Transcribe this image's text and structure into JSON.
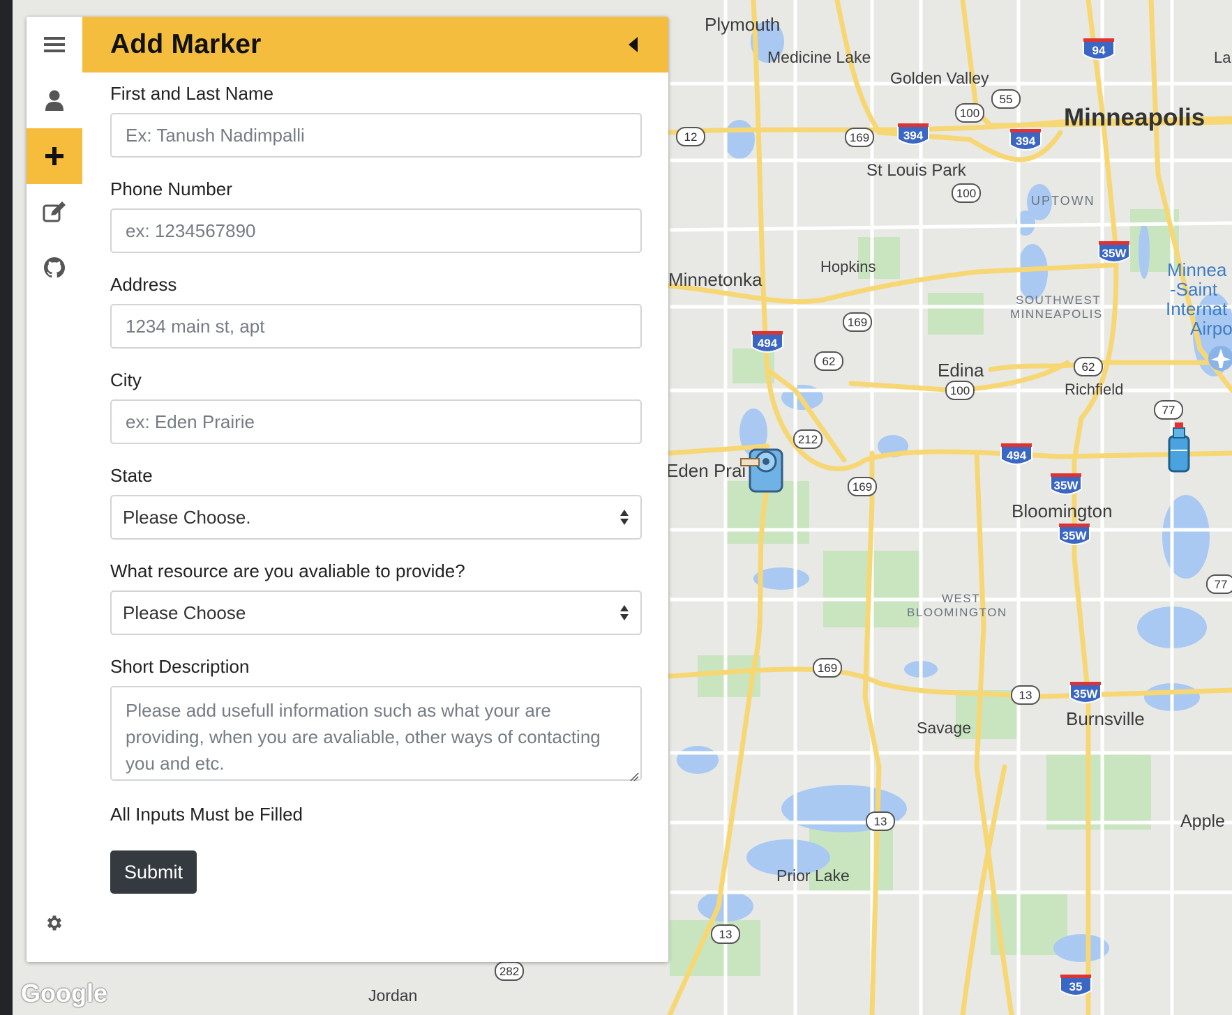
{
  "map": {
    "labels": {
      "plymouth": "Plymouth",
      "medicine_lake": "Medicine Lake",
      "golden_valley": "Golden Valley",
      "minneapolis": "Minneapolis",
      "st_louis_park": "St Louis Park",
      "uptown": "UPTOWN",
      "minnetonka": "Minnetonka",
      "hopkins": "Hopkins",
      "southwest_1": "SOUTHWEST",
      "southwest_2": "MINNEAPOLIS",
      "airport_1": "Minnea",
      "airport_2": "-Saint",
      "airport_3": "Internat",
      "airport_4": "Airpo",
      "edina": "Edina",
      "richfield": "Richfield",
      "eden_prairie": "Eden Prai",
      "bloomington": "Bloomington",
      "west_bloom_1": "WEST",
      "west_bloom_2": "BLOOMINGTON",
      "savage": "Savage",
      "burnsville": "Burnsville",
      "apple": "Apple",
      "prior_lake": "Prior Lake",
      "jordan": "Jordan",
      "la": "La"
    },
    "shields": [
      "94",
      "55",
      "100",
      "169",
      "394",
      "394",
      "12",
      "100",
      "35W",
      "494",
      "169",
      "62",
      "62",
      "100",
      "77",
      "212",
      "169",
      "494",
      "35W",
      "35W",
      "77",
      "169",
      "13",
      "35W",
      "13",
      "13",
      "282",
      "35"
    ],
    "attribution": "Google",
    "colors": {
      "land": "#e8e8e4",
      "water": "#a9c9f2",
      "park": "#c8e5c0",
      "highway": "#f7d774",
      "road": "#ffffff",
      "interstate": "#3a66c4"
    }
  },
  "sidebar": {
    "tabs": [
      {
        "name": "menu",
        "icon": "hamburger-icon"
      },
      {
        "name": "profile",
        "icon": "user-icon"
      },
      {
        "name": "add-marker",
        "icon": "plus-icon",
        "active": true
      },
      {
        "name": "edit",
        "icon": "edit-icon"
      },
      {
        "name": "github",
        "icon": "github-icon"
      }
    ],
    "bottom_icon": "gear-icon",
    "accent": "#f4bd3e"
  },
  "panel": {
    "title": "Add Marker",
    "form": {
      "name_label": "First and Last Name",
      "name_placeholder": "Ex: Tanush Nadimpalli",
      "phone_label": "Phone Number",
      "phone_placeholder": "ex: 1234567890",
      "address_label": "Address",
      "address_placeholder": "1234 main st, apt",
      "city_label": "City",
      "city_placeholder": "ex: Eden Prairie",
      "state_label": "State",
      "state_selected": "Please Choose.",
      "resource_label": "What resource are you avaliable to provide?",
      "resource_selected": "Please Choose",
      "desc_label": "Short Description",
      "desc_placeholder": "Please add usefull information such as what your are providing, when you are avaliable, other ways of contacting you and etc.",
      "note": "All Inputs Must be Filled",
      "submit_label": "Submit"
    }
  }
}
